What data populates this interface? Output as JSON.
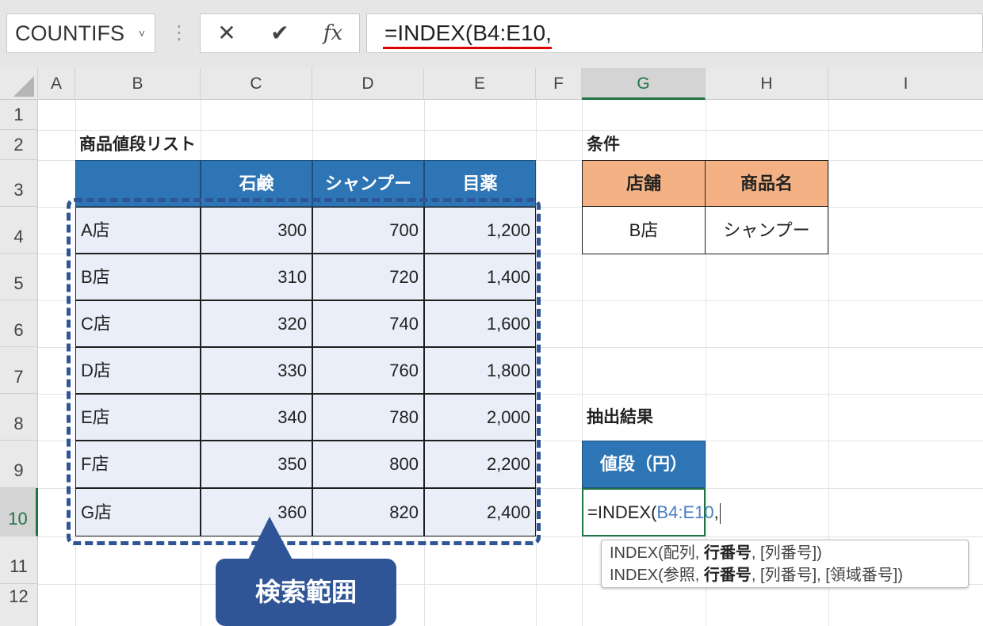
{
  "formula_bar": {
    "name_box": "COUNTIFS",
    "dropdown_glyph": "˅",
    "separator": "⋮",
    "cancel_glyph": "✕",
    "enter_glyph": "✔",
    "fx_glyph": "fx",
    "formula": "=INDEX(B4:E10,"
  },
  "columns": [
    "A",
    "B",
    "C",
    "D",
    "E",
    "F",
    "G",
    "H",
    "I"
  ],
  "selected_column": "G",
  "rows": [
    "1",
    "2",
    "3",
    "4",
    "5",
    "6",
    "7",
    "8",
    "9",
    "10",
    "11",
    "12"
  ],
  "selected_row": "10",
  "price_table": {
    "title": "商品値段リスト",
    "headers": [
      "",
      "石鹸",
      "シャンプー",
      "目薬"
    ],
    "rows": [
      {
        "store": "A店",
        "values": [
          "300",
          "700",
          "1,200"
        ]
      },
      {
        "store": "B店",
        "values": [
          "310",
          "720",
          "1,400"
        ]
      },
      {
        "store": "C店",
        "values": [
          "320",
          "740",
          "1,600"
        ]
      },
      {
        "store": "D店",
        "values": [
          "330",
          "760",
          "1,800"
        ]
      },
      {
        "store": "E店",
        "values": [
          "340",
          "780",
          "2,000"
        ]
      },
      {
        "store": "F店",
        "values": [
          "350",
          "800",
          "2,200"
        ]
      },
      {
        "store": "G店",
        "values": [
          "360",
          "820",
          "2,400"
        ]
      }
    ]
  },
  "conditions": {
    "title": "条件",
    "headers": [
      "店舗",
      "商品名"
    ],
    "values": [
      "B店",
      "シャンプー"
    ]
  },
  "result": {
    "title": "抽出結果",
    "header": "値段（円）",
    "editing_prefix": "=INDEX(",
    "editing_range": "B4:E10",
    "editing_suffix": ","
  },
  "tooltip": {
    "line1_a": "INDEX(配列, ",
    "line1_b": "行番号",
    "line1_c": ", [列番号])",
    "line2_a": "INDEX(参照, ",
    "line2_b": "行番号",
    "line2_c": ", [列番号], [領域番号])"
  },
  "callout": {
    "label": "検索範囲"
  },
  "colors": {
    "table_header": "#2e75b6",
    "table_body": "#e9eef8",
    "condition_header": "#f4b183",
    "dashed_highlight": "#2f5597",
    "selected_header_text": "#217346",
    "formula_underline": "#e00000",
    "range_reference": "#4a7fc1"
  }
}
